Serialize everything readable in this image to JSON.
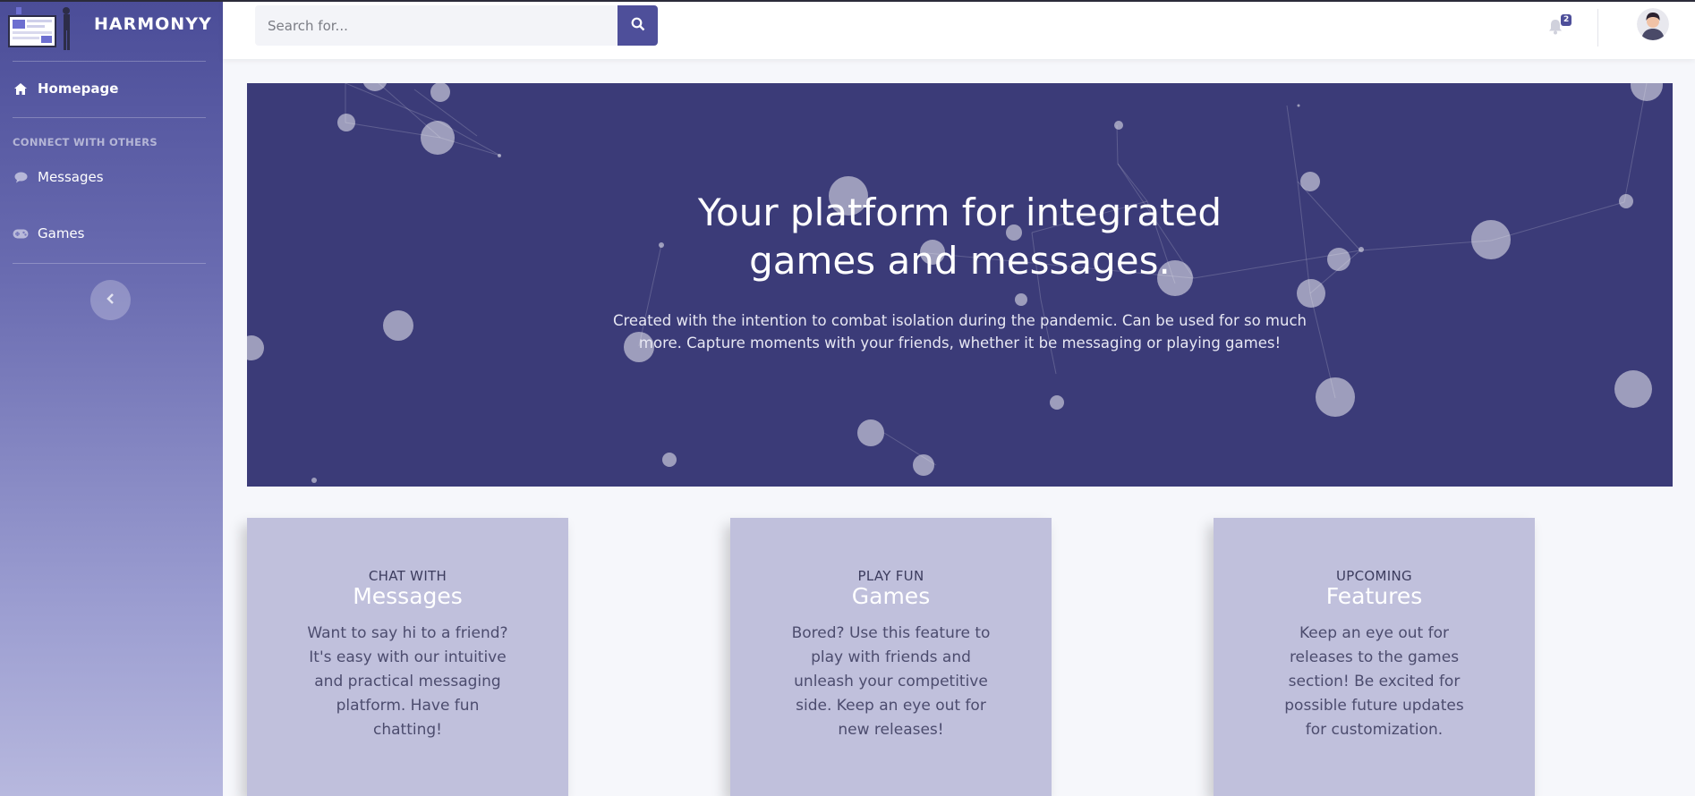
{
  "app": {
    "name": "HARMONYY"
  },
  "sidebar": {
    "homepage": {
      "label": "Homepage",
      "icon": "home-icon"
    },
    "section_heading": "CONNECT WITH OTHERS",
    "items": [
      {
        "label": "Messages",
        "icon": "chat-bubble-icon"
      },
      {
        "label": "Games",
        "icon": "gamepad-icon"
      }
    ],
    "collapse_icon": "chevron-left-icon"
  },
  "topbar": {
    "search_placeholder": "Search for...",
    "search_icon": "search-icon",
    "notifications_count": "2",
    "bell_icon": "bell-icon",
    "avatar_icon": "user-avatar-icon"
  },
  "hero": {
    "title_lines": [
      "Your platform for integrated",
      "games and messages."
    ],
    "text_lines": [
      "Created with the intention to combat isolation during the pandemic. Can be used for so much",
      "more. Capture moments with your friends, whether it be messaging or playing games!"
    ]
  },
  "cards": [
    {
      "kicker": "CHAT WITH",
      "title": "Messages",
      "desc_lines": [
        "Want to say hi to a friend?",
        "It's easy with our intuitive",
        "and practical messaging",
        "platform. Have fun",
        "chatting!"
      ]
    },
    {
      "kicker": "PLAY FUN",
      "title": "Games",
      "desc_lines": [
        "Bored? Use this feature to",
        "play with friends and",
        "unleash your competitive",
        "side. Keep an eye out for",
        "new releases!"
      ]
    },
    {
      "kicker": "UPCOMING",
      "title": "Features",
      "desc_lines": [
        "Keep an eye out for",
        "releases to the games",
        "section! Be excited for",
        "possible future updates",
        "for customization."
      ]
    }
  ],
  "colors": {
    "sidebar_top": "#4b4d98",
    "sidebar_bottom": "#b7b8de",
    "hero_bg": "#3b3b78",
    "accent": "#4e4f9a",
    "card_bg": "#c0c0dc"
  }
}
